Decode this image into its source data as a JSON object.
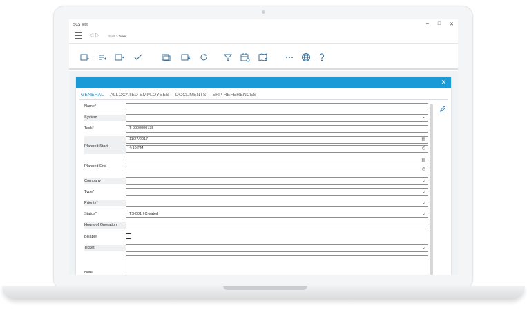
{
  "window": {
    "title": "SCS Test",
    "controls": {
      "minimize": "–",
      "maximize": "□",
      "close": "✕"
    }
  },
  "nav": {
    "breadcrumb_root": "Start",
    "breadcrumb_sep": " > ",
    "breadcrumb_current": "Ticket"
  },
  "toolbar": {
    "buttons": [
      {
        "icon": "new-card-icon"
      },
      {
        "icon": "add-list-icon"
      },
      {
        "icon": "card-forward-icon"
      },
      {
        "icon": "checkmark-icon"
      },
      {
        "icon": "copy-window-icon"
      },
      {
        "icon": "delete-card-icon"
      },
      {
        "icon": "refresh-icon"
      },
      {
        "icon": "filter-icon"
      },
      {
        "icon": "calendar-settings-icon"
      },
      {
        "icon": "map-pin-icon"
      },
      {
        "icon": "more-icon"
      },
      {
        "icon": "globe-icon"
      },
      {
        "icon": "help-icon"
      }
    ]
  },
  "dialog": {
    "close": "✕",
    "tabs": [
      "GENERAL",
      "ALLOCATED EMPLOYEES",
      "DOCUMENTS",
      "ERP REFERENCES"
    ],
    "fields": {
      "name_label": "Name*",
      "system_label": "System",
      "task_label": "Task*",
      "task_value": "T-0000000135",
      "planned_start_label": "Planned Start",
      "planned_start_date": "11/27/2017",
      "planned_start_time": "4:10 PM",
      "planned_end_label": "Planned End",
      "company_label": "Company",
      "type_label": "Type*",
      "priority_label": "Priority*",
      "status_label": "Status*",
      "status_value": "TS-001 | Created",
      "hours_label": "Hours of Operation",
      "billable_label": "Billable",
      "ticket_label": "Ticket",
      "note_label": "Note"
    }
  },
  "colors": {
    "accent": "#1a9ad6",
    "tab_active": "#1a7fb5",
    "icon": "#3a6f98"
  }
}
